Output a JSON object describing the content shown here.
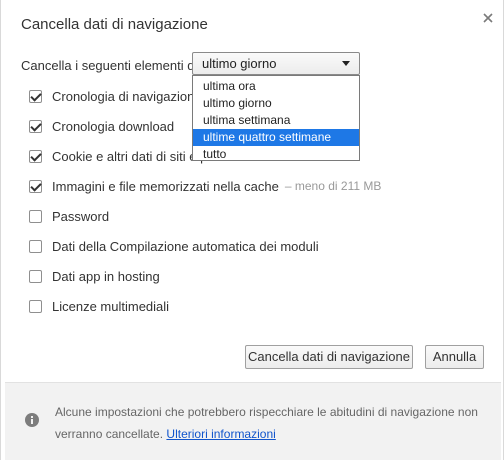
{
  "dialog": {
    "title": "Cancella dati di navigazione",
    "range_label": "Cancella i seguenti elementi da:",
    "range_selected": "ultimo giorno",
    "range_options": [
      "ultima ora",
      "ultimo giorno",
      "ultima settimana",
      "ultime quattro settimane",
      "tutto"
    ],
    "range_highlighted": "ultime quattro settimane",
    "options": [
      {
        "label": "Cronologia di navigazione",
        "checked": true
      },
      {
        "label": "Cronologia download",
        "checked": true
      },
      {
        "label": "Cookie e altri dati di siti e p",
        "checked": true
      },
      {
        "label": "Immagini e file memorizzati nella cache",
        "checked": true,
        "extra": "–  meno di 211 MB"
      },
      {
        "label": "Password",
        "checked": false
      },
      {
        "label": "Dati della Compilazione automatica dei moduli",
        "checked": false
      },
      {
        "label": "Dati app in hosting",
        "checked": false
      },
      {
        "label": "Licenze multimediali",
        "checked": false
      }
    ],
    "clear_button": "Cancella dati di navigazione",
    "cancel_button": "Annulla",
    "footer_text": "Alcune impostazioni che potrebbero rispecchiare le abitudini di navigazione non verranno cancellate.",
    "footer_link": "Ulteriori informazioni"
  },
  "colors": {
    "highlight": "#1e78e6",
    "link": "#1155cc",
    "footer_bg": "#f2f2f2"
  },
  "icons": {
    "close": "close-icon",
    "info": "info-icon",
    "dropdown": "chevron-down-icon",
    "checkbox": "checkmark-icon"
  }
}
